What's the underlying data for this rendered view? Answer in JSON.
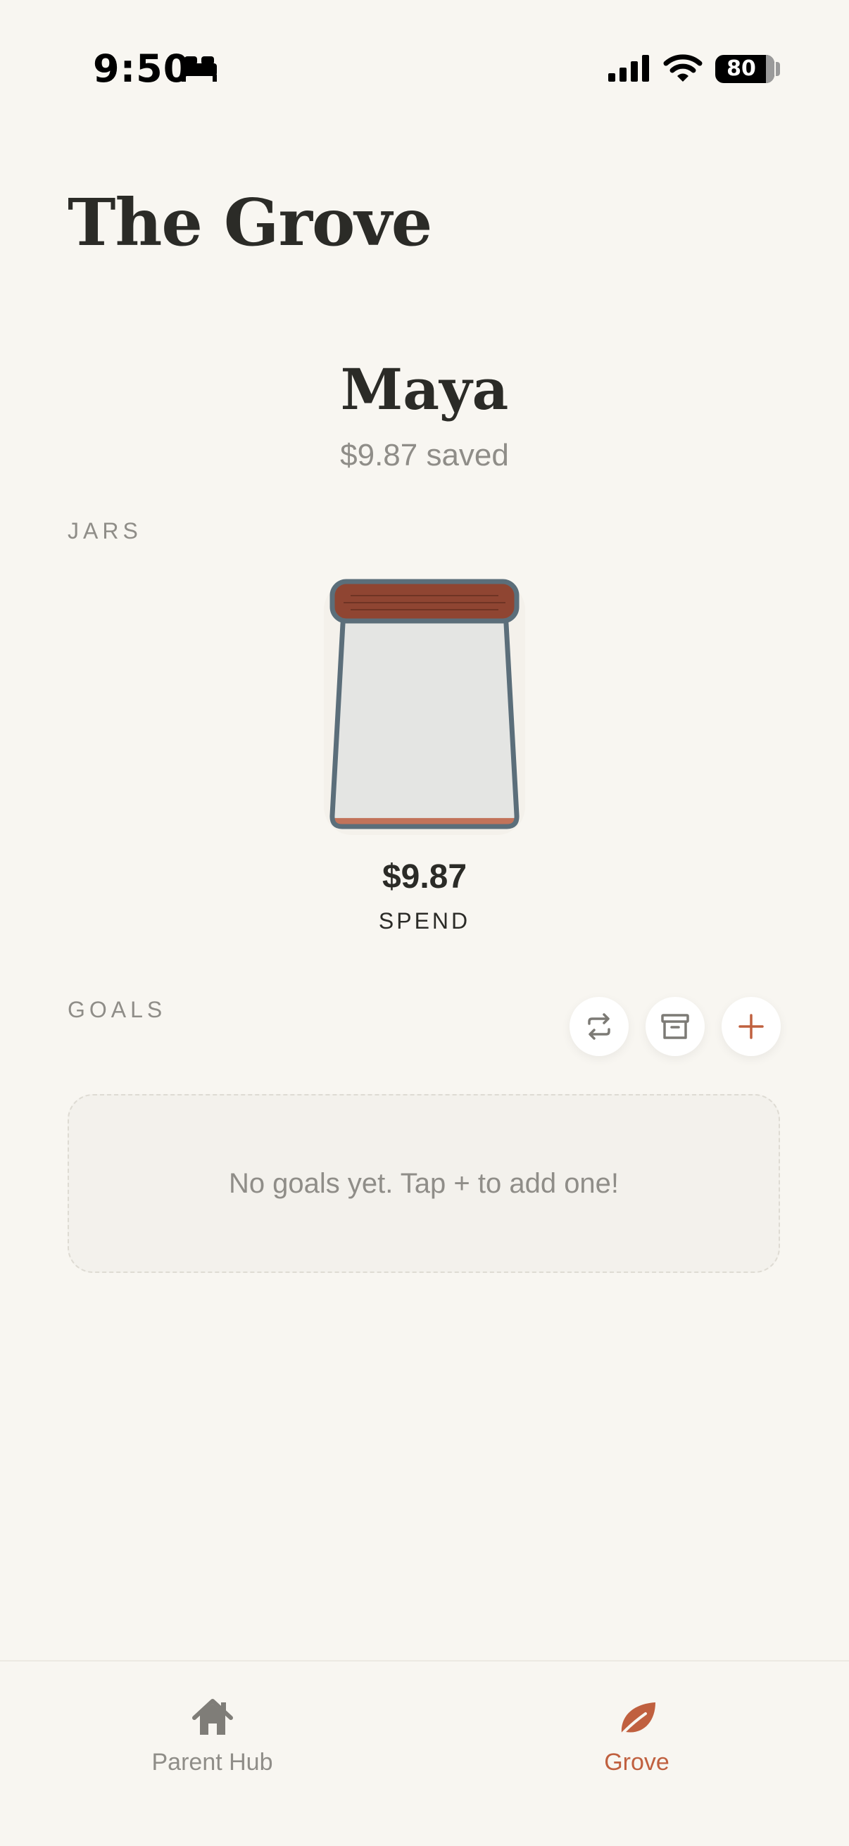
{
  "status_bar": {
    "time": "9:50",
    "battery": "80",
    "icons": [
      "bed-icon",
      "cellular-signal-icon",
      "wifi-icon",
      "battery-icon"
    ]
  },
  "header": {
    "title": "The Grove"
  },
  "profile": {
    "name": "Maya",
    "saved_text": "$9.87 saved"
  },
  "jars": {
    "section_label": "JARS",
    "items": [
      {
        "amount": "$9.87",
        "label": "SPEND",
        "fill_fraction": 0.04,
        "icon": "jar-icon"
      }
    ]
  },
  "goals": {
    "section_label": "GOALS",
    "actions": [
      {
        "name": "transfer",
        "icon": "transfer-arrows-icon"
      },
      {
        "name": "archive",
        "icon": "archive-box-icon"
      },
      {
        "name": "add",
        "icon": "plus-icon"
      }
    ],
    "empty_text": "No goals yet. Tap + to add one!"
  },
  "tab_bar": {
    "items": [
      {
        "label": "Parent Hub",
        "icon": "house-icon",
        "active": false
      },
      {
        "label": "Grove",
        "icon": "leaf-icon",
        "active": true
      }
    ]
  },
  "colors": {
    "background": "#f8f6f1",
    "accent": "#c0603f",
    "jar_lid": "#8f4532",
    "jar_outline": "#5b6e7a",
    "muted_text": "#8f8d88",
    "dark_text": "#2b2b27"
  }
}
